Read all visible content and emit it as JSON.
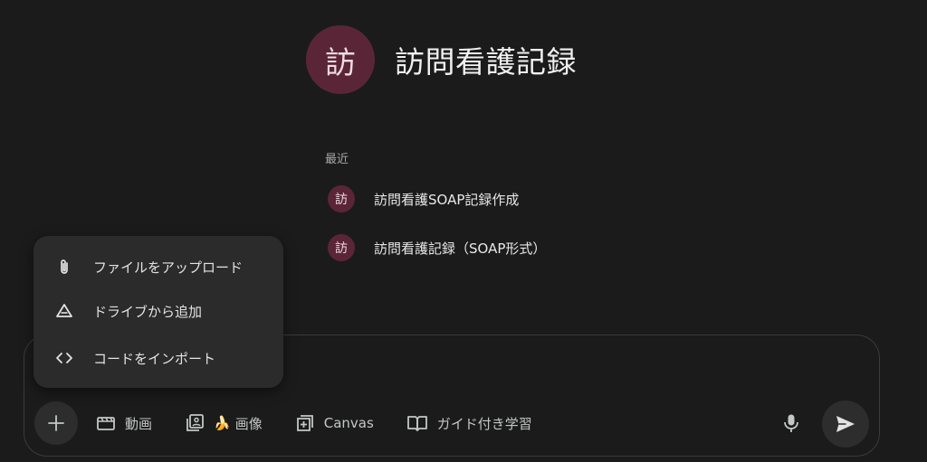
{
  "header": {
    "avatar_char": "訪",
    "title": "訪問看護記録"
  },
  "recent": {
    "label": "最近",
    "items": [
      {
        "icon_char": "訪",
        "label": "訪問看護SOAP記録作成"
      },
      {
        "icon_char": "訪",
        "label": "訪問看護記録（SOAP形式）"
      }
    ]
  },
  "menu": {
    "items": [
      {
        "icon": "paperclip-icon",
        "label": "ファイルをアップロード"
      },
      {
        "icon": "drive-icon",
        "label": "ドライブから追加"
      },
      {
        "icon": "code-icon",
        "label": "コードをインポート"
      }
    ]
  },
  "toolbar": {
    "plus_icon": "plus-icon",
    "video": {
      "icon": "video-icon",
      "label": "動画"
    },
    "image": {
      "icon": "image-icon",
      "emoji": "🍌",
      "label": "画像"
    },
    "canvas": {
      "icon": "canvas-icon",
      "label": "Canvas"
    },
    "guided": {
      "icon": "book-icon",
      "label": "ガイド付き学習"
    },
    "mic_icon": "microphone-icon",
    "send_icon": "send-icon"
  },
  "colors": {
    "background": "#1b1b1c",
    "avatar_bg": "#5a2637",
    "menu_bg": "#2b2b2c",
    "button_bg": "#2d2d2e",
    "text": "#e3e3e3"
  }
}
